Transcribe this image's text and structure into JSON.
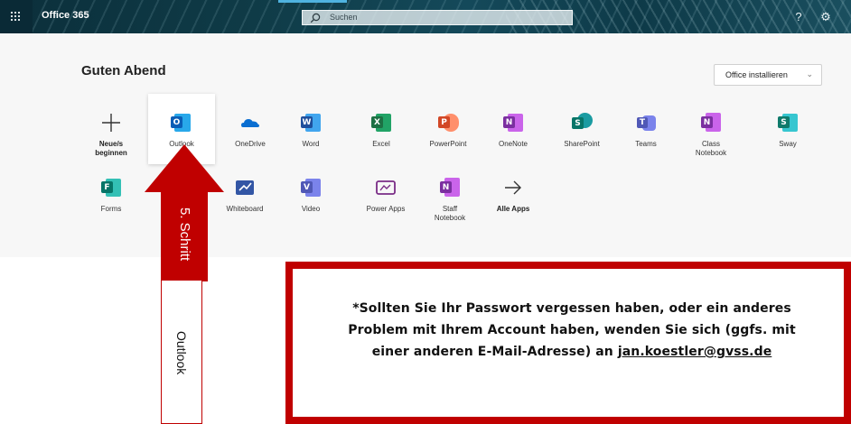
{
  "topbar": {
    "brand": "Office 365",
    "search_placeholder": "Suchen",
    "icons": [
      "waffle-icon",
      "search-icon",
      "help-icon",
      "settings-icon"
    ],
    "bg_color": "#0f3b47"
  },
  "greeting": "Guten Abend",
  "install_button": "Office installieren",
  "apps_row1": [
    {
      "label": "Neue/s",
      "label2": "beginnen",
      "icon": "plus-icon",
      "bold": true
    },
    {
      "label": "Outlook",
      "label2": "",
      "icon": "outlook-icon",
      "color": "#0a6ed1",
      "letter": "O"
    },
    {
      "label": "OneDrive",
      "label2": "",
      "icon": "onedrive-icon",
      "color": "#0a6ed1"
    },
    {
      "label": "Word",
      "label2": "",
      "icon": "word-icon",
      "color": "#1e4f9c",
      "letter": "W"
    },
    {
      "label": "Excel",
      "label2": "",
      "icon": "excel-icon",
      "color": "#1d7044",
      "letter": "X"
    },
    {
      "label": "PowerPoint",
      "label2": "",
      "icon": "powerpoint-icon",
      "color": "#d24726",
      "letter": "P"
    },
    {
      "label": "OneNote",
      "label2": "",
      "icon": "onenote-icon",
      "color": "#7b2fa0",
      "letter": "N"
    },
    {
      "label": "SharePoint",
      "label2": "",
      "icon": "sharepoint-icon",
      "color": "#077568",
      "letter": "S"
    },
    {
      "label": "Teams",
      "label2": "",
      "icon": "teams-icon",
      "color": "#5058b6",
      "letter": "T"
    },
    {
      "label": "Class",
      "label2": "Notebook",
      "icon": "class-notebook-icon",
      "color": "#7b2fa0",
      "letter": "N"
    },
    {
      "label": "Sway",
      "label2": "",
      "icon": "sway-icon",
      "color": "#0f7a6b",
      "letter": "S"
    }
  ],
  "apps_row2": [
    {
      "label": "Forms",
      "label2": "",
      "icon": "forms-icon",
      "color": "#077568",
      "letter": "F"
    },
    {
      "label": "Whiteboard",
      "label2": "",
      "icon": "whiteboard-icon",
      "color": "#3356a5"
    },
    {
      "label": "Video",
      "label2": "",
      "icon": "video-icon",
      "color": "#5058b6",
      "letter": "V"
    },
    {
      "label": "Power Apps",
      "label2": "",
      "icon": "power-apps-icon",
      "color": "#7a2c86"
    },
    {
      "label": "Staff",
      "label2": "Notebook",
      "icon": "staff-notebook-icon",
      "color": "#7b2fa0",
      "letter": "N"
    },
    {
      "label": "Alle Apps",
      "label2": "",
      "icon": "arrow-right-icon",
      "bold": true
    }
  ],
  "annotation": {
    "arrow_text": "5. Schritt",
    "box_text": "Outlook",
    "color": "#c00000"
  },
  "notice": {
    "line1": "*Sollten Sie Ihr Passwort vergessen haben, oder ein anderes",
    "line2": "Problem mit Ihrem Account haben, wenden Sie sich (ggfs. mit",
    "line3_prefix": "einer anderen E-Mail-Adresse) an",
    "email": "jan.koestler@gvss.de"
  }
}
